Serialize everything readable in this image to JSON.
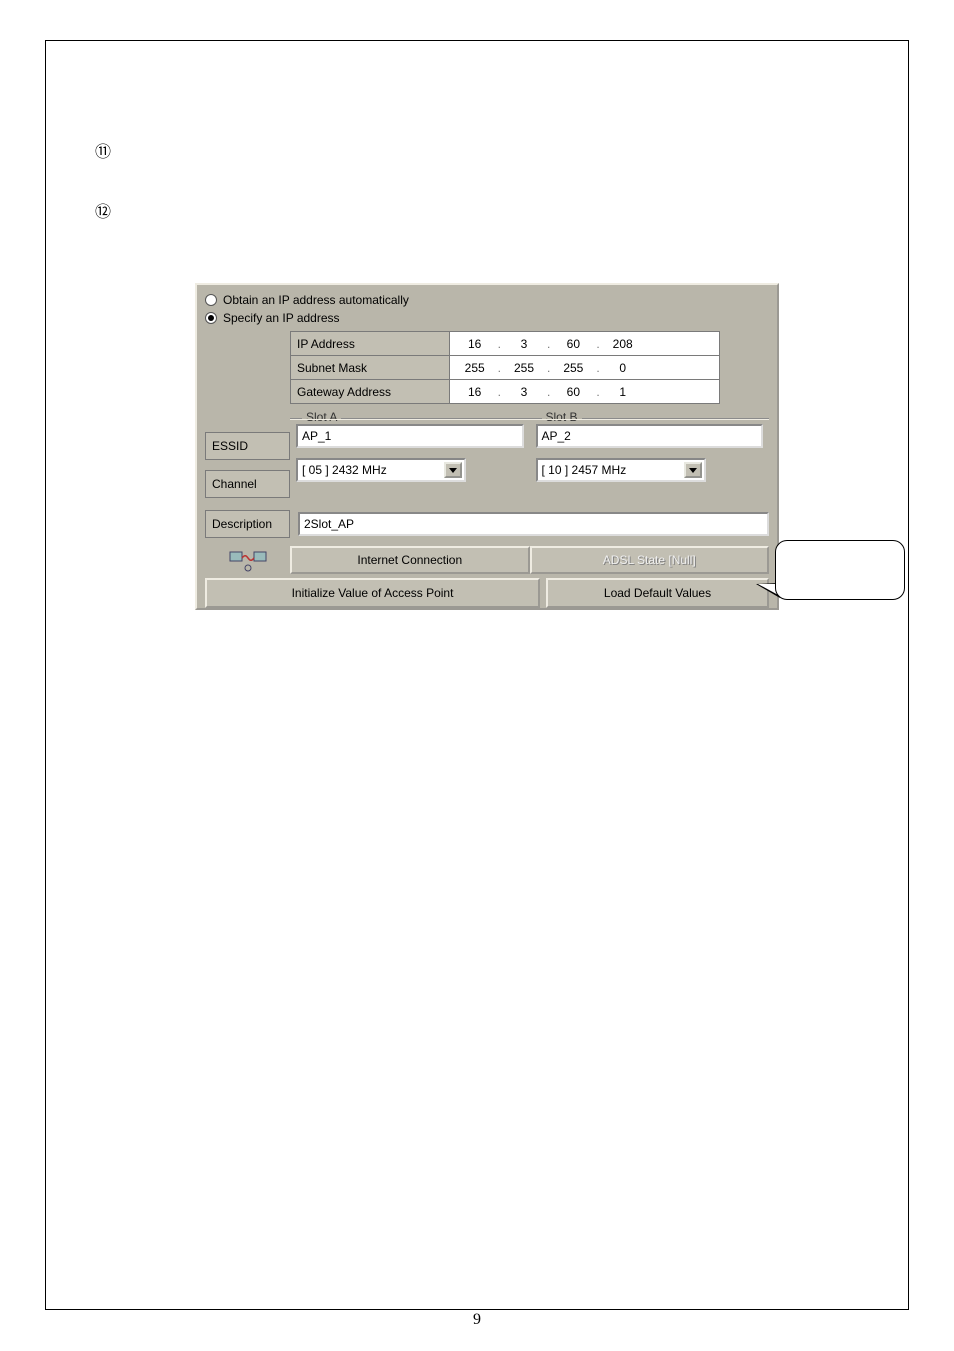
{
  "marks": {
    "m11": "⑪",
    "m12": "⑫"
  },
  "radio": {
    "auto_label": "Obtain an IP address automatically",
    "specify_label": "Specify an IP address",
    "selected": "specify"
  },
  "ip_settings": {
    "ip_address_label": "IP Address",
    "ip_address": {
      "o1": "16",
      "o2": "3",
      "o3": "60",
      "o4": "208"
    },
    "subnet_label": "Subnet Mask",
    "subnet": {
      "o1": "255",
      "o2": "255",
      "o3": "255",
      "o4": "0"
    },
    "gateway_label": "Gateway Address",
    "gateway": {
      "o1": "16",
      "o2": "3",
      "o3": "60",
      "o4": "1"
    }
  },
  "row_labels": {
    "essid": "ESSID",
    "channel": "Channel",
    "description": "Description"
  },
  "slot_a": {
    "legend": "Slot A",
    "essid": "AP_1",
    "channel": "[ 05 ] 2432 MHz"
  },
  "slot_b": {
    "legend": "Slot B",
    "essid": "AP_2",
    "channel": "[ 10 ] 2457 MHz"
  },
  "description_value": "2Slot_AP",
  "buttons": {
    "internet": "Internet Connection",
    "adsl": "ADSL State [Null]",
    "init": "Initialize Value of Access Point",
    "load_default": "Load Default Values"
  },
  "page_number": "9"
}
